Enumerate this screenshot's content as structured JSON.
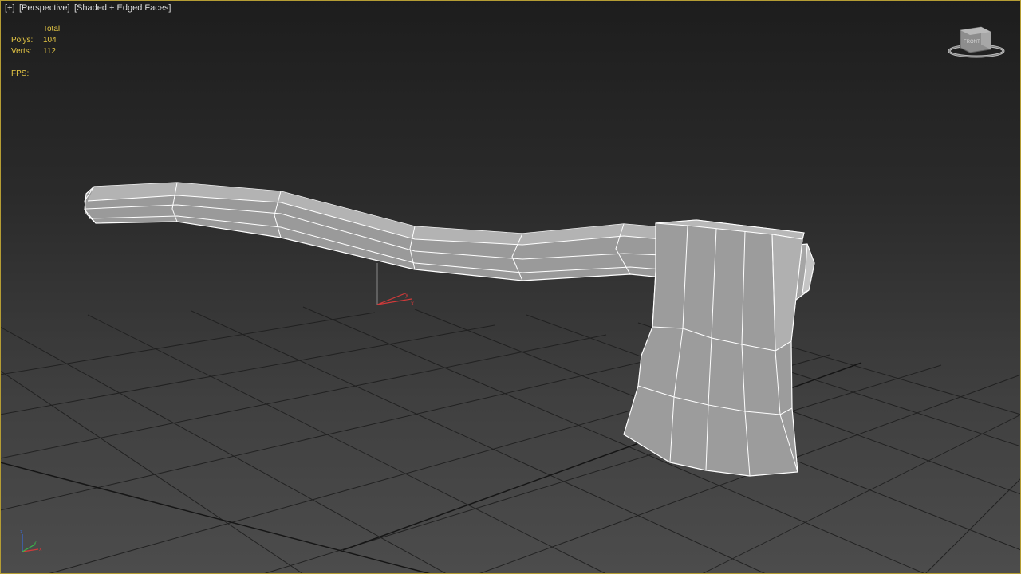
{
  "viewport": {
    "menu_label": "[+]",
    "view_label": "[Perspective]",
    "shading_label": "[Shaded + Edged Faces]"
  },
  "stats": {
    "header": "Total",
    "polys_label": "Polys:",
    "polys_value": "104",
    "verts_label": "Verts:",
    "verts_value": "112",
    "fps_label": "FPS:"
  },
  "viewcube": {
    "face_label": "FRONT"
  },
  "pivot_gizmo": {
    "x_label": "x",
    "y_label": "y"
  },
  "axis_tripod": {
    "x_label": "x",
    "y_label": "y",
    "z_label": "z"
  },
  "colors": {
    "active_viewport_border": "#b59d34",
    "stats_text": "#e7c845",
    "mesh_fill": "#9a9a9a",
    "mesh_edges": "#ffffff",
    "grid": "#1e1e1e",
    "axis_x": "#d23a3a",
    "axis_y": "#3ab94a",
    "axis_z": "#3a6ad6"
  }
}
